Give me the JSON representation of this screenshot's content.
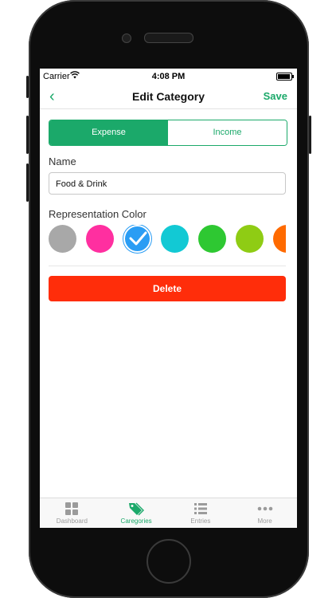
{
  "status": {
    "carrier": "Carrier",
    "time": "4:08 PM"
  },
  "nav": {
    "back": "‹",
    "title": "Edit Category",
    "save": "Save"
  },
  "segment": {
    "items": [
      {
        "label": "Expense",
        "active": true
      },
      {
        "label": "Income",
        "active": false
      }
    ]
  },
  "name": {
    "label": "Name",
    "value": "Food & Drink"
  },
  "color": {
    "label": "Representation Color",
    "swatches": [
      "#a8a8a8",
      "#ff2fa0",
      "#2a9df4",
      "#12c9d4",
      "#2ec832",
      "#8fcc14",
      "#ff6a00"
    ],
    "selected": 2
  },
  "delete_label": "Delete",
  "tabs": [
    {
      "label": "Dashboard",
      "icon": "grid-icon"
    },
    {
      "label": "Caregories",
      "icon": "tag-icon"
    },
    {
      "label": "Entries",
      "icon": "list-icon"
    },
    {
      "label": "More",
      "icon": "more-icon"
    }
  ],
  "active_tab": 1
}
